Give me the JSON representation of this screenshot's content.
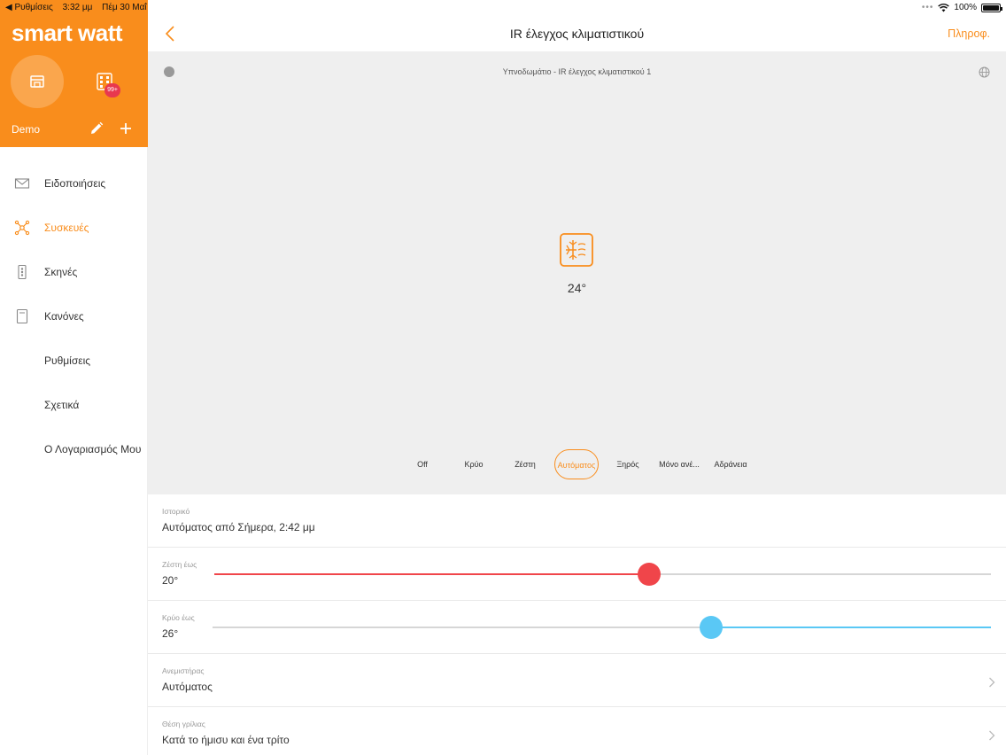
{
  "status_bar": {
    "back_app": "◀ Ρυθμίσεις",
    "time": "3:32 μμ",
    "date": "Πέμ 30 Μαΐ",
    "battery": "100%"
  },
  "sidebar": {
    "logo": "smart watt",
    "badge": "99+",
    "home_name": "Demo",
    "items": [
      {
        "label": "Ειδοποιήσεις",
        "icon": "mail-icon",
        "active": false
      },
      {
        "label": "Συσκευές",
        "icon": "devices-icon",
        "active": true
      },
      {
        "label": "Σκηνές",
        "icon": "scenes-icon",
        "active": false
      },
      {
        "label": "Κανόνες",
        "icon": "rules-icon",
        "active": false
      },
      {
        "label": "Ρυθμίσεις",
        "icon": "",
        "active": false
      },
      {
        "label": "Σχετικά",
        "icon": "",
        "active": false
      },
      {
        "label": "Ο Λογαριασμός Μου",
        "icon": "",
        "active": false
      }
    ]
  },
  "header": {
    "title": "IR έλεγχος κλιματιστικού",
    "info": "Πληροφ."
  },
  "control": {
    "subtitle": "Υπνοδωμάτιο - IR έλεγχος κλιματιστικού 1",
    "temperature": "24°",
    "modes": [
      "Off",
      "Κρύο",
      "Ζέστη",
      "Αυτόματος",
      "Ξηρός",
      "Μόνο ανέ...",
      "Αδράνεια"
    ],
    "selected_mode": "Αυτόματος"
  },
  "rows": {
    "history": {
      "caption": "Ιστορικό",
      "value": "Αυτόματος από Σήμερα, 2:42 μμ"
    },
    "heat": {
      "caption": "Ζέστη έως",
      "value": "20°",
      "level": 0.56
    },
    "cool": {
      "caption": "Κρύο έως",
      "value": "26°",
      "level": 0.64
    },
    "fan": {
      "caption": "Ανεμιστήρας",
      "value": "Αυτόματος"
    },
    "vane": {
      "caption": "Θέση γρίλιας",
      "value": "Κατά το ήμισυ και ένα τρίτο"
    }
  },
  "colors": {
    "accent": "#f98d1c",
    "heat": "#f0454a",
    "cool": "#5ac8f5",
    "badge": "#e8384f"
  }
}
